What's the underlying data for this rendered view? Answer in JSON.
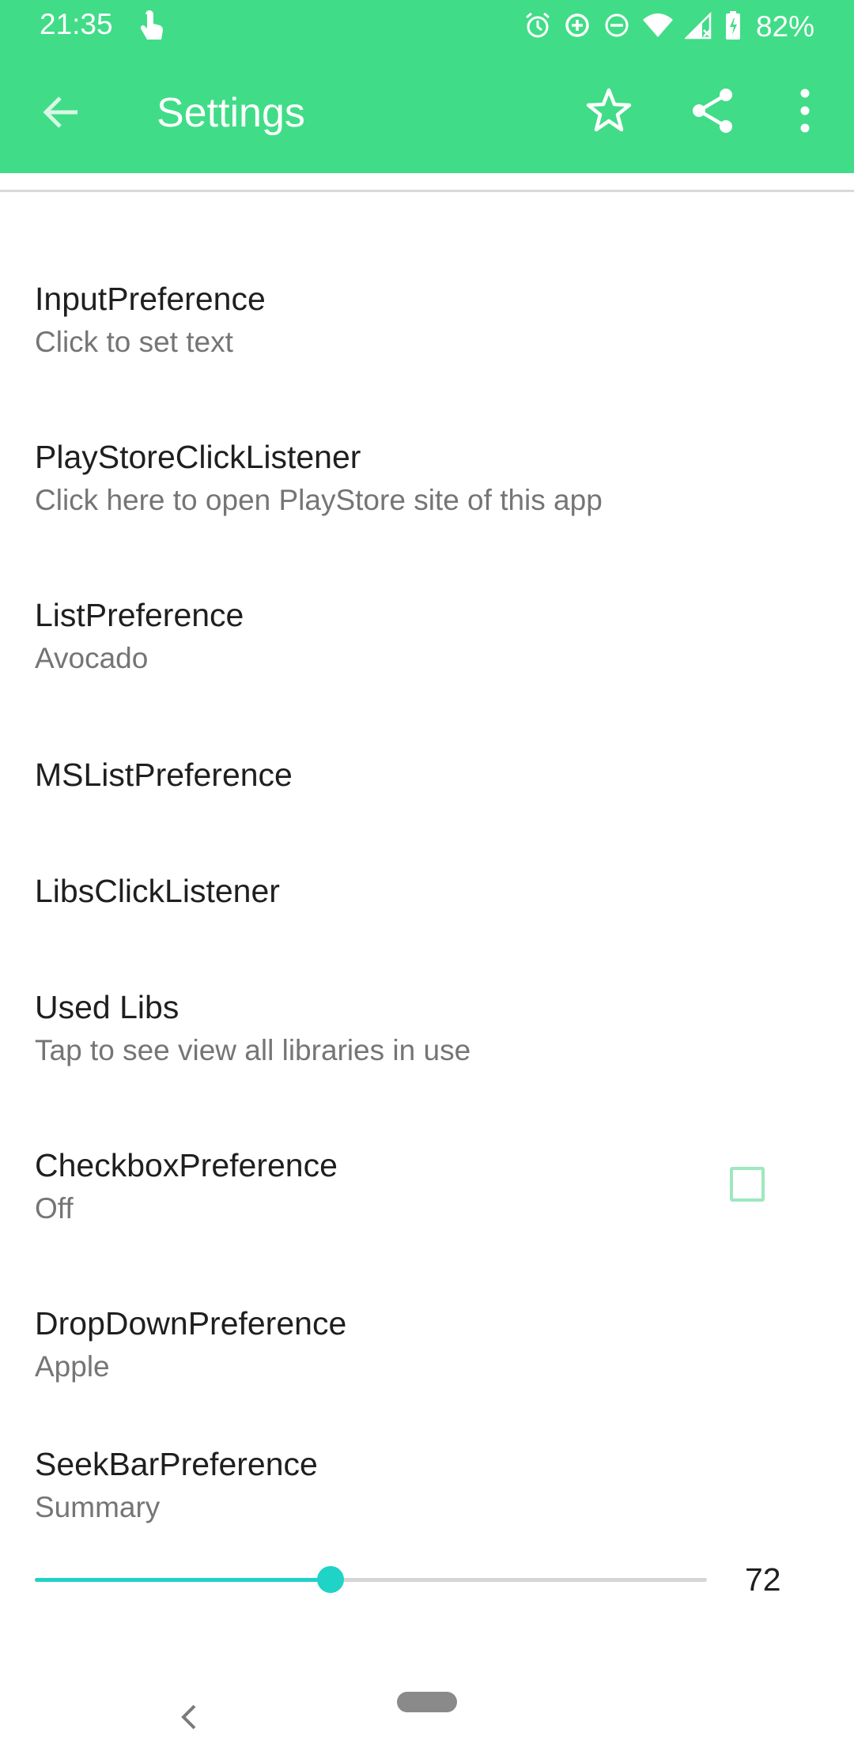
{
  "status_bar": {
    "time": "21:35",
    "battery_percent": "82%",
    "icons": [
      "touch-icon",
      "alarm-icon",
      "data-saver-icon",
      "dnd-icon",
      "wifi-icon",
      "signal-icon",
      "battery-icon"
    ]
  },
  "toolbar": {
    "title": "Settings",
    "back_icon": "arrow-back-icon",
    "actions": [
      "star-icon",
      "share-icon",
      "more-vert-icon"
    ]
  },
  "preferences": [
    {
      "title": "InputPreference",
      "summary": "Click to set text"
    },
    {
      "title": "PlayStoreClickListener",
      "summary": "Click here to open PlayStore site of this app"
    },
    {
      "title": "ListPreference",
      "summary": "Avocado"
    },
    {
      "title": "MSListPreference",
      "summary": ""
    },
    {
      "title": "LibsClickListener",
      "summary": ""
    },
    {
      "title": "Used Libs",
      "summary": "Tap to see view all libraries in use"
    },
    {
      "title": "CheckboxPreference",
      "summary": "Off",
      "checked": false
    },
    {
      "title": "DropDownPreference",
      "summary": "Apple"
    },
    {
      "title": "SeekBarPreference",
      "summary": "Summary",
      "value": "72",
      "fraction": 0.44
    }
  ],
  "colors": {
    "accent": "#41dc87",
    "seekbar": "#1fd3c6",
    "checkbox_border": "#9fe7bf",
    "title_text": "#1f1f1f",
    "summary_text": "#757575"
  }
}
